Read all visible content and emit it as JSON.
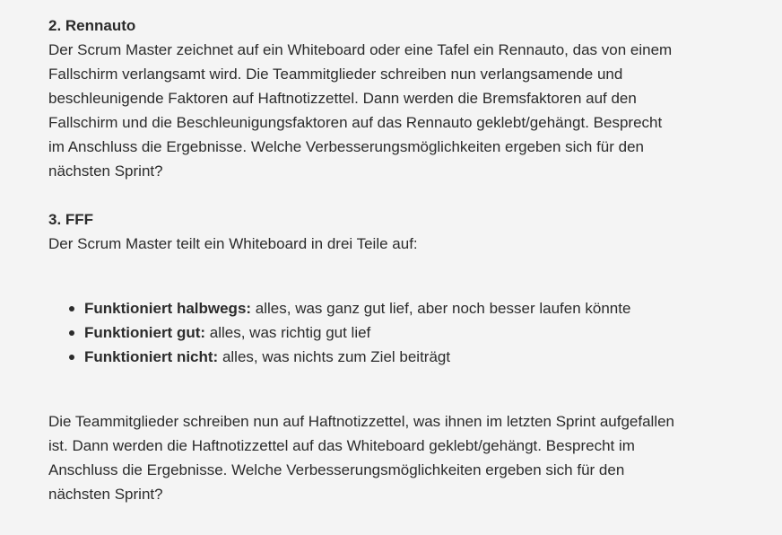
{
  "section2": {
    "heading": "2. Rennauto",
    "text": "Der Scrum Master zeichnet auf ein Whiteboard oder eine Tafel ein Rennauto, das von einem Fallschirm verlangsamt wird. Die Teammitglieder schreiben nun verlangsamende und beschleunigende Faktoren auf Haftnotizzettel. Dann werden die Bremsfaktoren auf den Fallschirm und die Beschleunigungsfaktoren auf das Rennauto geklebt/gehängt. Besprecht im Anschluss die Ergebnisse. Welche Verbesserungsmöglichkeiten ergeben sich für den nächsten Sprint?"
  },
  "section3": {
    "heading": "3. FFF",
    "intro": "Der Scrum Master teilt ein Whiteboard in drei Teile auf:",
    "items": [
      {
        "term": "Funktioniert halbwegs:",
        "desc": " alles, was ganz gut lief, aber noch besser laufen könnte"
      },
      {
        "term": "Funktioniert gut:",
        "desc": " alles, was richtig gut lief"
      },
      {
        "term": "Funktioniert nicht:",
        "desc": " alles, was nichts zum Ziel beiträgt"
      }
    ],
    "outro": "Die Teammitglieder schreiben nun auf Haftnotizzettel, was ihnen im letzten Sprint aufgefallen ist. Dann werden die Haftnotizzettel auf das Whiteboard geklebt/gehängt. Besprecht im Anschluss die Ergebnisse. Welche Verbesserungsmöglichkeiten ergeben sich für den nächsten Sprint?"
  }
}
